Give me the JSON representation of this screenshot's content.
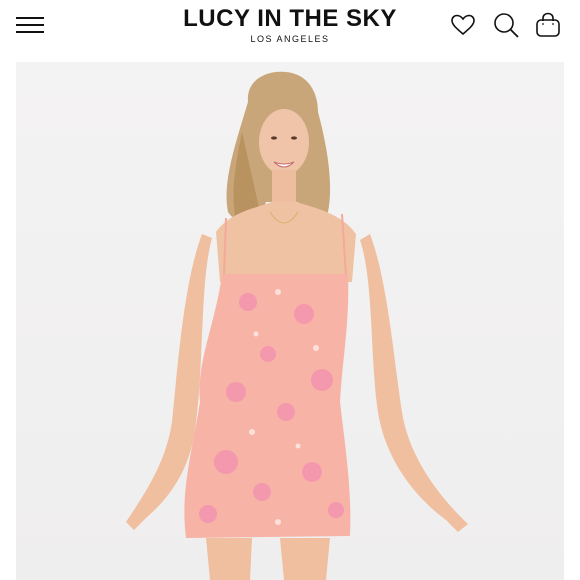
{
  "header": {
    "brand_title": "LUCY IN THE SKY",
    "brand_subtitle": "LOS ANGELES",
    "icons": [
      "menu-icon",
      "heart-icon",
      "search-icon",
      "bag-icon"
    ]
  },
  "colors": {
    "background": "#ffffff",
    "text": "#111111",
    "dress": "#f7b4a6",
    "image_background": "#f1f0f0"
  }
}
